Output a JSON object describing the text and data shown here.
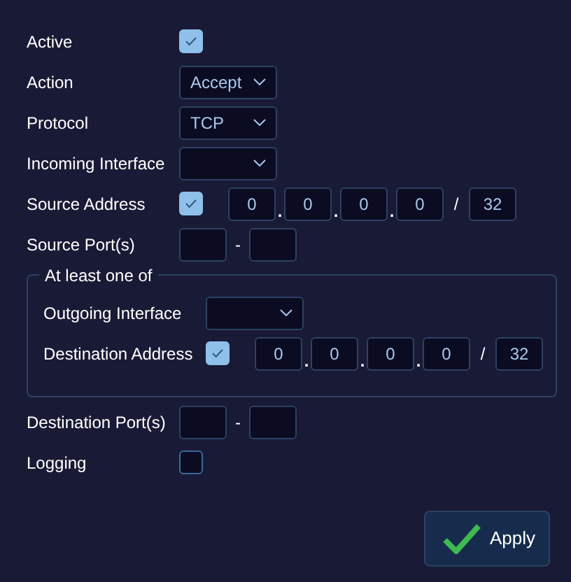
{
  "rows": [
    {
      "kind": "checkbox",
      "label": "Active",
      "checked": true
    },
    {
      "kind": "dropdown",
      "label": "Action",
      "value": "Accept"
    },
    {
      "kind": "dropdown",
      "label": "Protocol",
      "value": "TCP"
    },
    {
      "kind": "dropdown",
      "label": "Incoming Interface"
    },
    {
      "kind": "address",
      "label": "Source Address",
      "checked": true,
      "octets": [
        "0",
        "0",
        "0",
        "0"
      ],
      "separator": ".",
      "slash": "/",
      "prefix": "32"
    },
    {
      "kind": "ports",
      "label": "Source Port(s)",
      "dash": "-"
    }
  ],
  "group": {
    "title": "At least one of",
    "rows": [
      {
        "kind": "dropdown",
        "label": "Outgoing Interface"
      },
      {
        "kind": "address",
        "label": "Destination Address",
        "checked": true,
        "octets": [
          "0",
          "0",
          "0",
          "0"
        ],
        "separator": ".",
        "slash": "/",
        "prefix": "32"
      }
    ]
  },
  "rows_after": [
    {
      "kind": "ports",
      "label": "Destination Port(s)",
      "dash": "-"
    },
    {
      "kind": "checkbox",
      "label": "Logging",
      "checked": false
    }
  ],
  "apply_button": {
    "label": "Apply"
  }
}
